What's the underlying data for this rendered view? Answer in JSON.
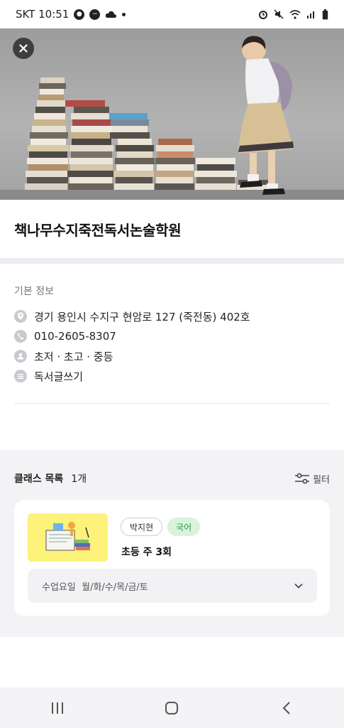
{
  "status_bar": {
    "carrier_time": "SKT 10:51",
    "icons": [
      "talk-icon",
      "minus-circle-icon",
      "cloud-icon",
      "dot-icon",
      "alarm-icon",
      "mute-icon",
      "wifi-icon",
      "signal-icon",
      "battery-icon"
    ]
  },
  "hero": {
    "close_icon": "close-icon"
  },
  "academy": {
    "title": "책나무수지죽전독서논술학원"
  },
  "basic_info": {
    "heading": "기본 정보",
    "address": "경기 용인시 수지구 현암로 127 (죽전동) 402호",
    "phone": "010-2605-8307",
    "target": "초저 · 초고 · 중등",
    "subject": "독서글쓰기"
  },
  "class_list": {
    "title": "클래스 목록",
    "count": "1개",
    "filter_label": "필터",
    "items": [
      {
        "teacher": "박지현",
        "subject": "국어",
        "name": "초등 주 3회",
        "days": "수업요일  월/화/수/목/금/토"
      }
    ]
  },
  "colors": {
    "accent_green": "#2f9a43",
    "chip_green_bg": "#d9f3dd",
    "thumb_yellow": "#fdf27a",
    "section_bg": "#f3f3f6"
  },
  "nav_bar": {
    "icons": [
      "recent-apps-icon",
      "home-icon",
      "back-icon"
    ]
  }
}
